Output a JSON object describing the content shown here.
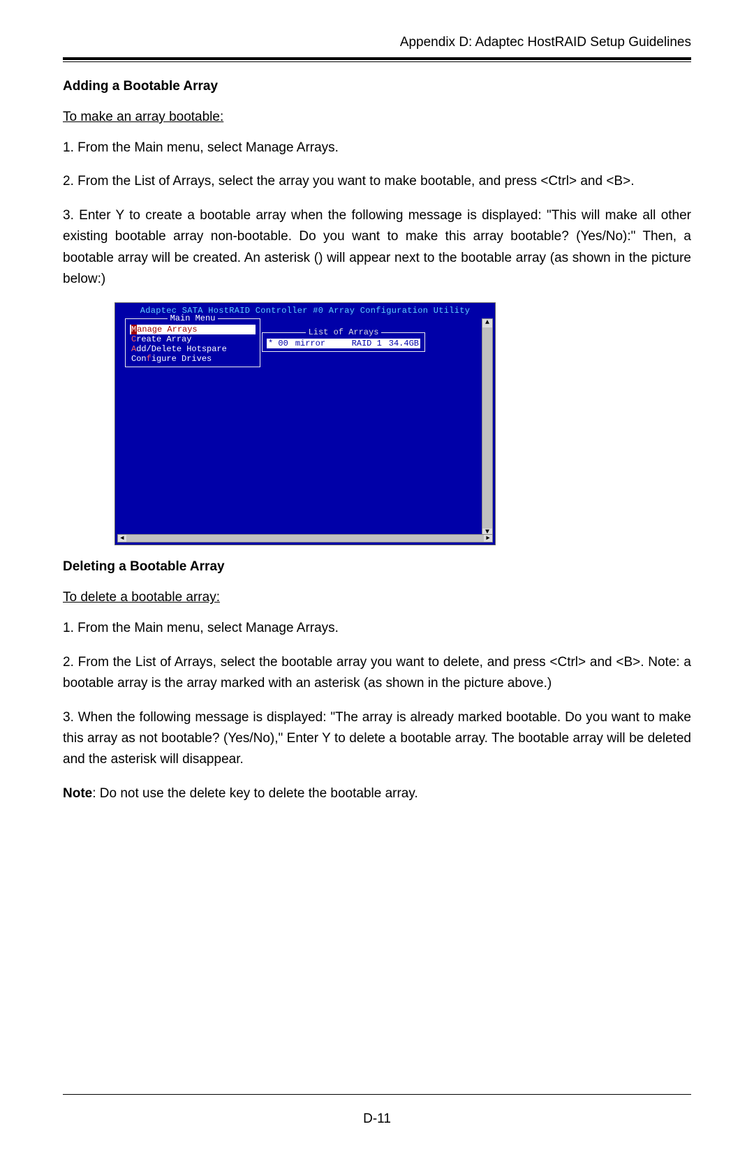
{
  "header": {
    "title": "Appendix D:  Adaptec HostRAID Setup Guidelines"
  },
  "section1": {
    "title": "Adding a Bootable Array",
    "subhead": "To make an array bootable:",
    "p1": "1. From the Main menu, select Manage Arrays.",
    "p2": "2. From the List of Arrays, select the array you want to make bootable, and press <Ctrl> and <B>.",
    "p3": "3. Enter Y to create a bootable array when the following message is displayed: \"This will make all other existing bootable array non-bootable. Do you want to make this array bootable? (Yes/No):\"  Then, a bootable array will be created.  An asterisk () will appear next to the bootable array (as shown in the picture below:)"
  },
  "bios": {
    "title": "Adaptec SATA HostRAID Controller #0 Array Configuration Utility",
    "main_menu_label": "Main Menu",
    "menu_items": {
      "sel_first": "M",
      "sel_rest": "anage Arrays",
      "i1_first": "C",
      "i1_rest": "reate Array",
      "i2_first": "A",
      "i2_rest": "dd/Delete Hotspare",
      "i3_first": "Con",
      "i3_mid": "f",
      "i3_rest": "igure Drives"
    },
    "list_label": "List of Arrays",
    "row": {
      "mark": "* 00",
      "name": "mirror",
      "type": "RAID 1",
      "size": "34.4GB"
    }
  },
  "section2": {
    "title": "Deleting a Bootable Array",
    "subhead": "To delete a bootable array:",
    "p1": "1. From the Main menu, select Manage Arrays.",
    "p2": "2. From the List of Arrays, select the bootable array you want to delete, and press <Ctrl> and <B>. Note: a bootable array is the array marked with an asterisk   (as shown in the picture above.)",
    "p3": "3. When the following message is displayed: \"The array is already marked bootable. Do you want to make this array as not bootable? (Yes/No),\" Enter Y to delete a bootable array.  The bootable array will be deleted and the asterisk will disappear.",
    "note_label": "Note",
    "note_rest": ": Do not use the delete key to delete the bootable array."
  },
  "page_number": "D-11"
}
